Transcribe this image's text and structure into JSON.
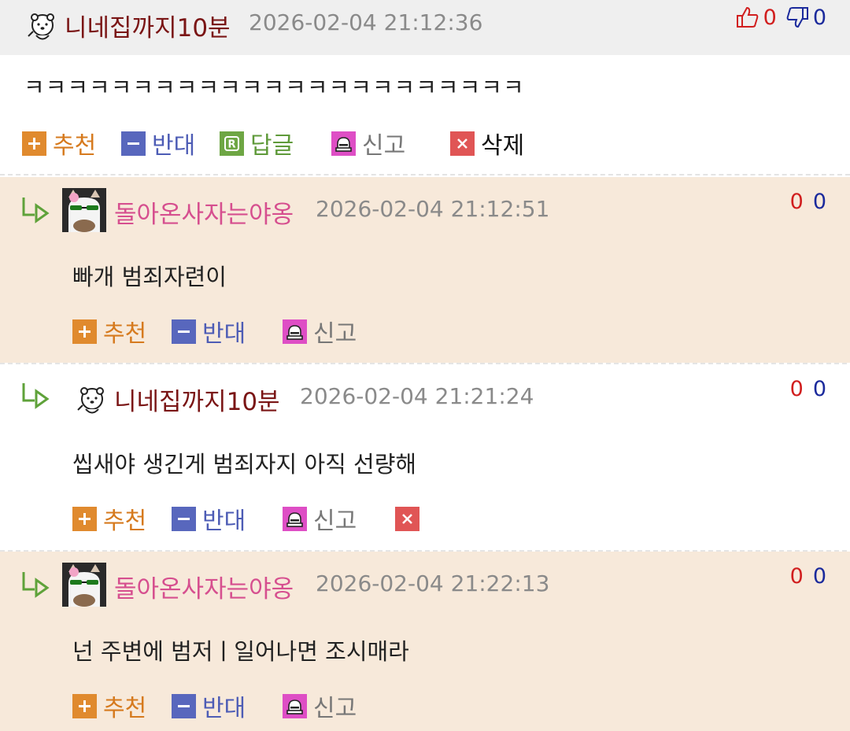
{
  "main_comment": {
    "nickname": "니네집까지10분",
    "timestamp": "2026-02-04 21:12:36",
    "content": "ㅋㅋㅋㅋㅋㅋㅋㅋㅋㅋㅋㅋㅋㅋㅋㅋㅋㅋㅋㅋㅋㅋㅋ",
    "likes": "0",
    "dislikes": "0",
    "actions": {
      "recommend": "추천",
      "oppose": "반대",
      "reply": "답글",
      "report": "신고",
      "delete": "삭제"
    }
  },
  "replies": [
    {
      "nickname": "돌아온사자는야옹",
      "timestamp": "2026-02-04 21:12:51",
      "content": "빠개 범죄자련이",
      "likes": "0",
      "dislikes": "0",
      "recommend": "추천",
      "oppose": "반대",
      "report": "신고"
    },
    {
      "nickname": "니네집까지10분",
      "timestamp": "2026-02-04 21:21:24",
      "content": "씹새야 생긴게 범죄자지 아직 선량해",
      "likes": "0",
      "dislikes": "0",
      "recommend": "추천",
      "oppose": "반대",
      "report": "신고"
    },
    {
      "nickname": "돌아온사자는야옹",
      "timestamp": "2026-02-04 21:22:13",
      "content": "넌 주변에 범저ㅣ일어나면 조시매라",
      "likes": "0",
      "dislikes": "0",
      "recommend": "추천",
      "oppose": "반대",
      "report": "신고"
    }
  ],
  "colors": {
    "header_bg": "#efefef",
    "reply_bg": "#f7e9da",
    "recommend": "#e08a2e",
    "oppose": "#5867bd",
    "reply": "#6ea644",
    "report": "#de4ec5",
    "delete": "#e05555",
    "like": "#d11f1f",
    "dislike": "#1b2a9c"
  }
}
